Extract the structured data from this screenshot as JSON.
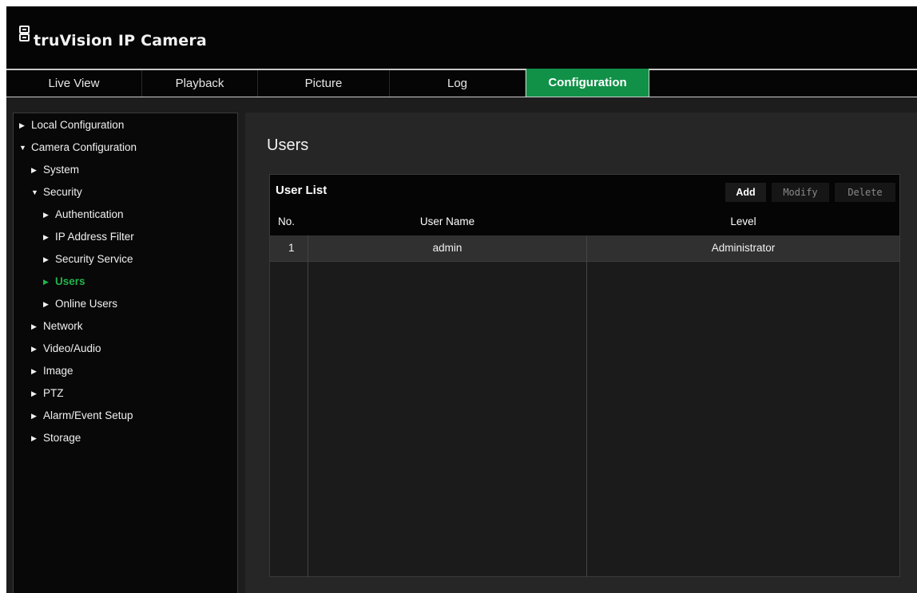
{
  "header": {
    "brand_logo_text": "truVision",
    "product": "IP Camera",
    "title": "truVision IP Camera"
  },
  "nav": {
    "tabs": [
      {
        "label": "Live View",
        "active": false
      },
      {
        "label": "Playback",
        "active": false
      },
      {
        "label": "Picture",
        "active": false
      },
      {
        "label": "Log",
        "active": false
      },
      {
        "label": "Configuration",
        "active": true
      }
    ]
  },
  "sidebar": {
    "items": [
      {
        "label": "Local Configuration",
        "level": 0,
        "expanded": false
      },
      {
        "label": "Camera Configuration",
        "level": 0,
        "expanded": true
      },
      {
        "label": "System",
        "level": 1,
        "expanded": false
      },
      {
        "label": "Security",
        "level": 1,
        "expanded": true
      },
      {
        "label": "Authentication",
        "level": 2,
        "expanded": false
      },
      {
        "label": "IP Address Filter",
        "level": 2,
        "expanded": false
      },
      {
        "label": "Security Service",
        "level": 2,
        "expanded": false
      },
      {
        "label": "Users",
        "level": 2,
        "expanded": false,
        "selected": true
      },
      {
        "label": "Online Users",
        "level": 2,
        "expanded": false
      },
      {
        "label": "Network",
        "level": 1,
        "expanded": false
      },
      {
        "label": "Video/Audio",
        "level": 1,
        "expanded": false
      },
      {
        "label": "Image",
        "level": 1,
        "expanded": false
      },
      {
        "label": "PTZ",
        "level": 1,
        "expanded": false
      },
      {
        "label": "Alarm/Event Setup",
        "level": 1,
        "expanded": false
      },
      {
        "label": "Storage",
        "level": 1,
        "expanded": false
      }
    ]
  },
  "main": {
    "page_title": "Users",
    "panel_title": "User List",
    "buttons": {
      "add": "Add",
      "modify": "Modify",
      "delete": "Delete"
    },
    "table": {
      "columns": [
        "No.",
        "User Name",
        "Level"
      ],
      "rows": [
        {
          "no": "1",
          "user_name": "admin",
          "level": "Administrator"
        }
      ]
    }
  },
  "colors": {
    "accent_green": "#119148",
    "selected_text_green": "#22b24c",
    "header_bg": "#050505",
    "content_bg": "#262626"
  },
  "icons": {
    "logo": "camera-logo-icon",
    "collapsed": "triangle-right-icon",
    "expanded": "triangle-down-icon"
  }
}
